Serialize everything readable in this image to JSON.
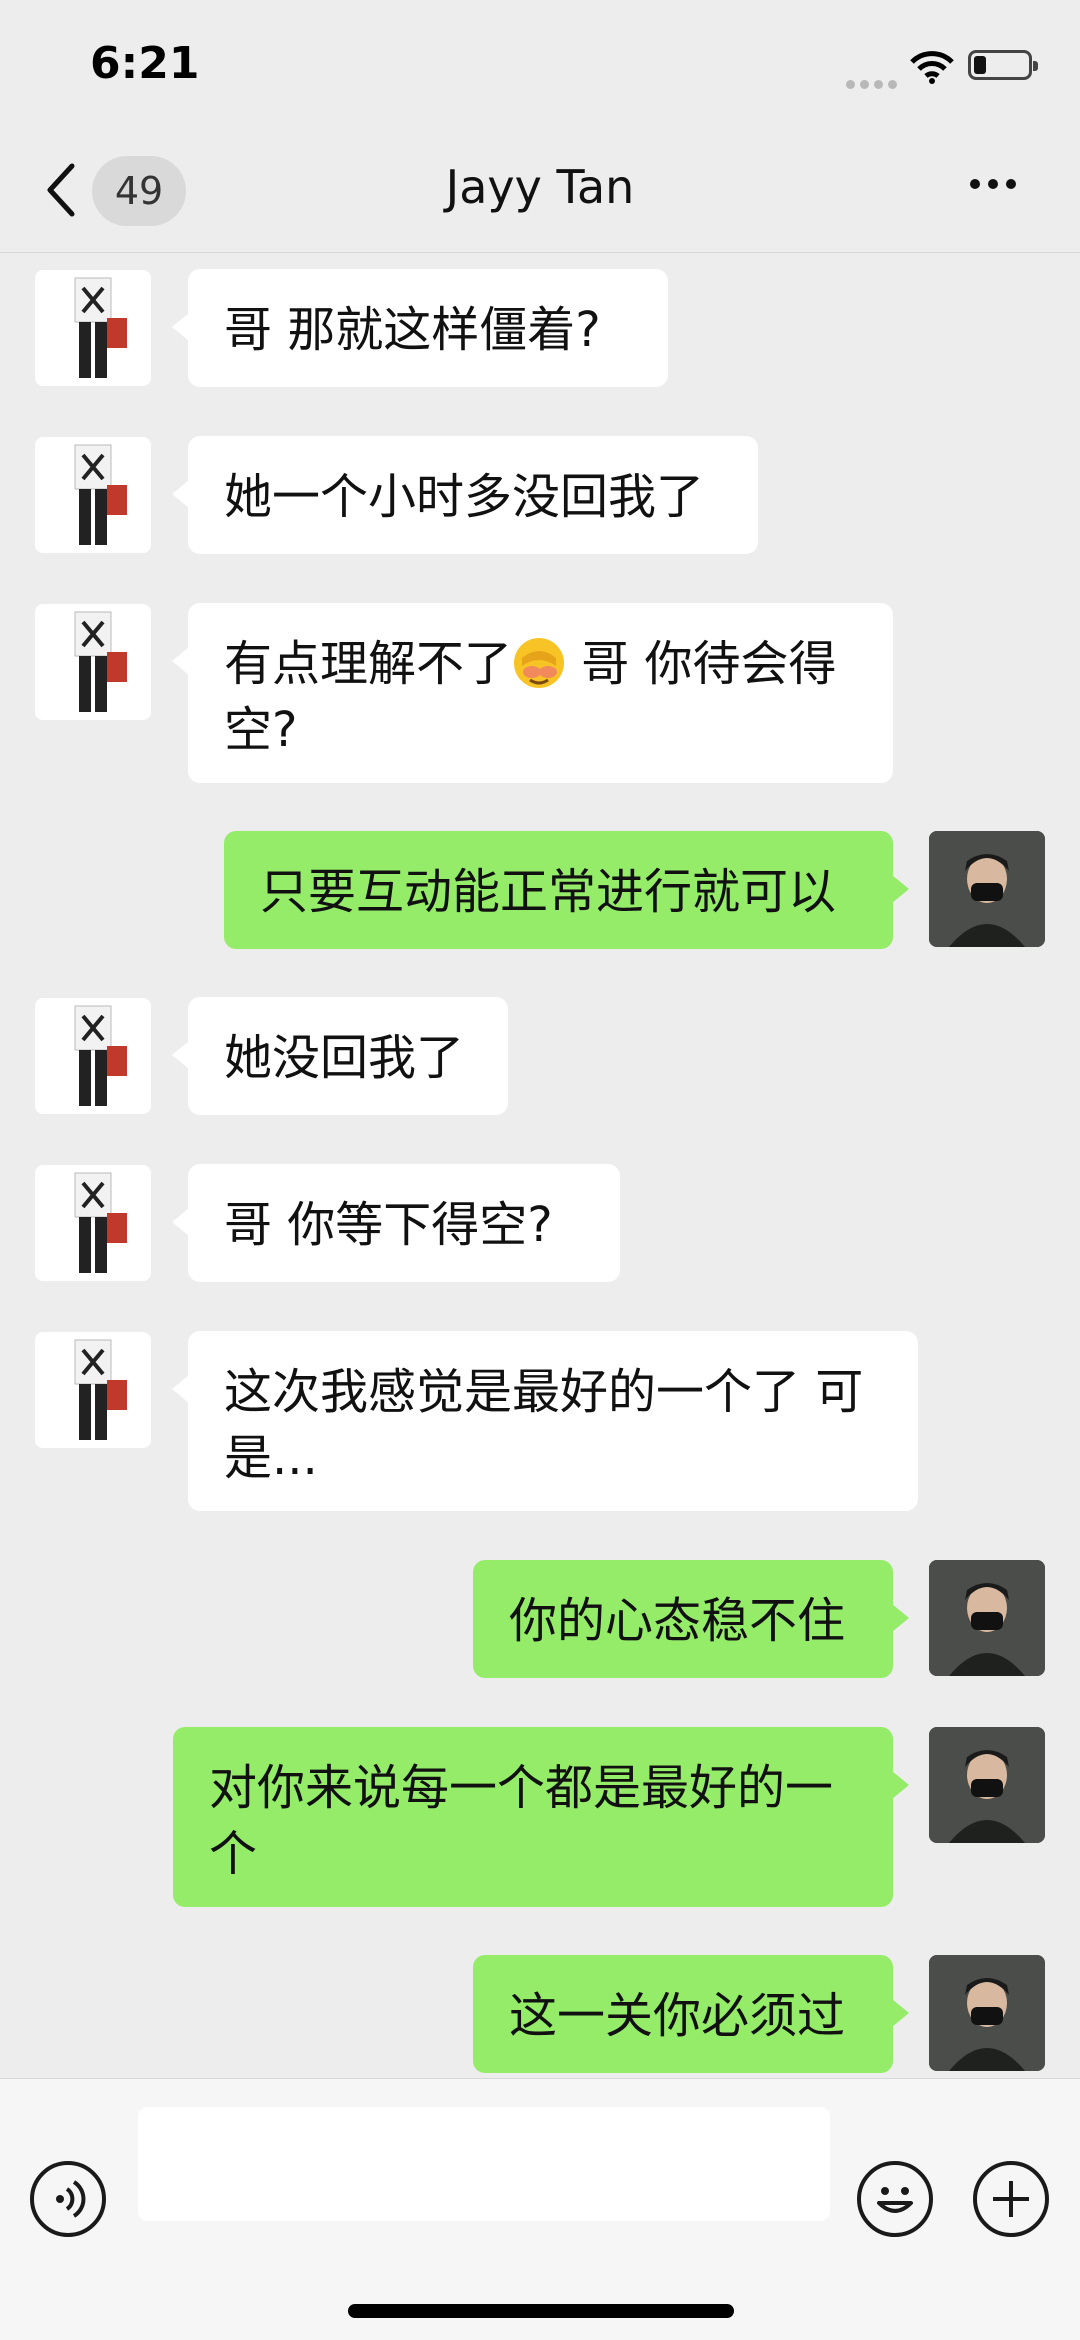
{
  "status_bar": {
    "time": "6:21"
  },
  "nav": {
    "unread_count": "49",
    "title": "Jayy Tan"
  },
  "messages": [
    {
      "side": "left",
      "text": "哥 那就这样僵着?"
    },
    {
      "side": "left",
      "text": "她一个小时多没回我了"
    },
    {
      "side": "left",
      "text_before_emoji": "有点理解不了",
      "emoji": "face-with-hand-over-eyes-emoji",
      "text_after_emoji": " 哥 你待会得空?"
    },
    {
      "side": "right",
      "text": "只要互动能正常进行就可以"
    },
    {
      "side": "left",
      "text": "她没回我了"
    },
    {
      "side": "left",
      "text": "哥 你等下得空?"
    },
    {
      "side": "left",
      "text": "这次我感觉是最好的一个了 可是..."
    },
    {
      "side": "right",
      "text": "你的心态稳不住"
    },
    {
      "side": "right",
      "text": "对你来说每一个都是最好的一个"
    },
    {
      "side": "right",
      "text": "这一关你必须过"
    }
  ],
  "input": {
    "value": "",
    "placeholder": ""
  },
  "colors": {
    "background": "#ededed",
    "self_bubble": "#95ec69",
    "contact_bubble": "#ffffff"
  }
}
